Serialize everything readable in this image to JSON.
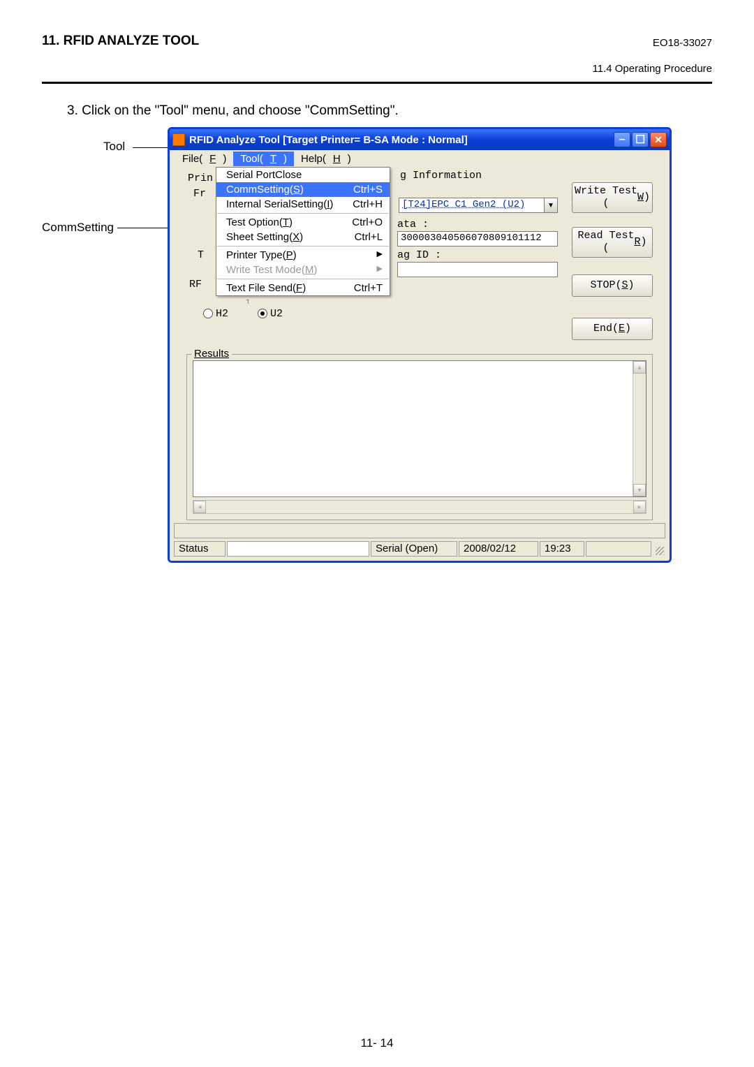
{
  "header": {
    "title": "11. RFID ANALYZE TOOL",
    "doc_id": "EO18-33027",
    "section": "11.4 Operating Procedure"
  },
  "instruction": "3.  Click on the \"Tool\" menu, and choose \"CommSetting\".",
  "callouts": {
    "tool": "Tool",
    "commsetting": "CommSetting"
  },
  "window": {
    "title": "RFID Analyze Tool [Target Printer= B-SA      Mode : Normal]",
    "menu": {
      "file": "File(F)",
      "tool": "Tool(T)",
      "help": "Help(H)"
    },
    "dropdown": {
      "serial_close": "Serial PortClose",
      "commsetting": "CommSetting(S)",
      "commsetting_sc": "Ctrl+S",
      "internal": "Internal SerialSetting(I)",
      "internal_sc": "Ctrl+H",
      "test_option": "Test Option(T)",
      "test_option_sc": "Ctrl+O",
      "sheet": "Sheet Setting(X)",
      "sheet_sc": "Ctrl+L",
      "printer_type": "Printer Type(P)",
      "write_mode": "Write Test Mode(M)",
      "text_file": "Text File Send(F)",
      "text_file_sc": "Ctrl+T"
    },
    "tag_group_title": "g Information",
    "combo_value": "[T24]EPC C1 Gen2 (U2)",
    "data_label": "ata :",
    "data_value": "300003040506070809101112",
    "tagid_label": "ag ID :",
    "buttons": {
      "write": "Write Test\n(W)",
      "read": "Read Test\n(R)",
      "stop": "STOP(S)",
      "end": "End(E)"
    },
    "peek": {
      "prin": "Prin",
      "fr": "Fr",
      "t": "T",
      "rf": "RF",
      "h2": "H2",
      "u2": "U2",
      "dashes": "-------------"
    },
    "results_title": "Results",
    "status": {
      "label": "Status",
      "conn": "Serial (Open)",
      "date": "2008/02/12",
      "time": "19:23"
    }
  },
  "page_number": "11- 14"
}
